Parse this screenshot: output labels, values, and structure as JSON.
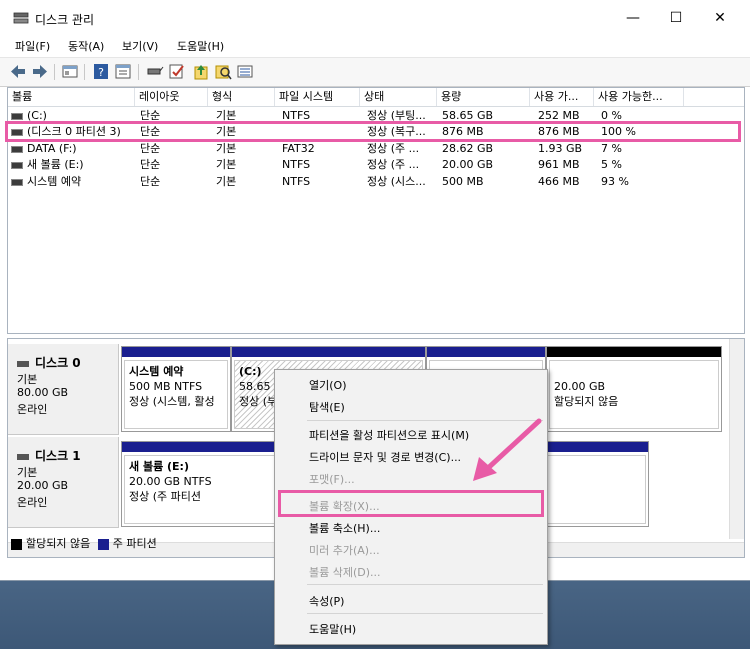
{
  "window": {
    "title": "디스크 관리",
    "controls": {
      "minimize": "—",
      "maximize": "☐",
      "close": "✕"
    }
  },
  "menubar": [
    "파일(F)",
    "동작(A)",
    "보기(V)",
    "도움말(H)"
  ],
  "toolbar": [
    "back-icon",
    "forward-icon",
    "console-icon",
    "help-icon",
    "properties-icon",
    "connect-icon",
    "check-icon",
    "up-icon",
    "search-icon",
    "list-icon"
  ],
  "volume_list": {
    "columns": [
      "볼륨",
      "레이아웃",
      "형식",
      "파일 시스템",
      "상태",
      "용량",
      "사용 가...",
      "사용 가능한..."
    ],
    "rows": [
      [
        "(C:)",
        "단순",
        "기본",
        "NTFS",
        "정상 (부팅...",
        "58.65 GB",
        "252 MB",
        "0 %"
      ],
      [
        "(디스크 0 파티션 3)",
        "단순",
        "기본",
        "",
        "정상 (복구...",
        "876 MB",
        "876 MB",
        "100 %"
      ],
      [
        "DATA (F:)",
        "단순",
        "기본",
        "FAT32",
        "정상 (주 ...",
        "28.62 GB",
        "1.93 GB",
        "7 %"
      ],
      [
        "새 볼륨 (E:)",
        "단순",
        "기본",
        "NTFS",
        "정상 (주 ...",
        "20.00 GB",
        "961 MB",
        "5 %"
      ],
      [
        "시스템 예약",
        "단순",
        "기본",
        "NTFS",
        "정상 (시스...",
        "500 MB",
        "466 MB",
        "93 %"
      ]
    ]
  },
  "disks": [
    {
      "name": "디스크 0",
      "type": "기본",
      "size": "80.00 GB",
      "status": "온라인",
      "partitions": [
        {
          "title": "시스템 예약",
          "info": "500 MB NTFS",
          "status": "정상 (시스템, 활성"
        },
        {
          "title": "(C:)",
          "info": "58.65 (",
          "status": "정상 (부"
        },
        {
          "title": "",
          "info": "",
          "status": ""
        },
        {
          "title": "",
          "info": "20.00 GB",
          "status": "할당되지 않음"
        }
      ]
    },
    {
      "name": "디스크 1",
      "type": "기본",
      "size": "20.00 GB",
      "status": "온라인",
      "partitions": [
        {
          "title": "새 볼륨  (E:)",
          "info": "20.00 GB NTFS",
          "status": "정상 (주 파티션"
        }
      ]
    }
  ],
  "legend": [
    {
      "label": "할당되지 않음",
      "color": "#000000"
    },
    {
      "label": "주 파티션",
      "color": "#1a1f8f"
    }
  ],
  "context_menu": {
    "items": [
      {
        "label": "열기(O)",
        "enabled": true
      },
      {
        "label": "탐색(E)",
        "enabled": true
      },
      {
        "label": "파티션을 활성 파티션으로 표시(M)",
        "enabled": true
      },
      {
        "label": "드라이브 문자 및 경로 변경(C)...",
        "enabled": true
      },
      {
        "label": "포맷(F)...",
        "enabled": false
      },
      {
        "label": "볼륨 확장(X)...",
        "enabled": false
      },
      {
        "label": "볼륨 축소(H)...",
        "enabled": true
      },
      {
        "label": "미러 추가(A)...",
        "enabled": false
      },
      {
        "label": "볼륨 삭제(D)...",
        "enabled": false
      },
      {
        "label": "속성(P)",
        "enabled": true
      },
      {
        "label": "도움말(H)",
        "enabled": true
      }
    ]
  },
  "highlight_color": "#e85ba6"
}
